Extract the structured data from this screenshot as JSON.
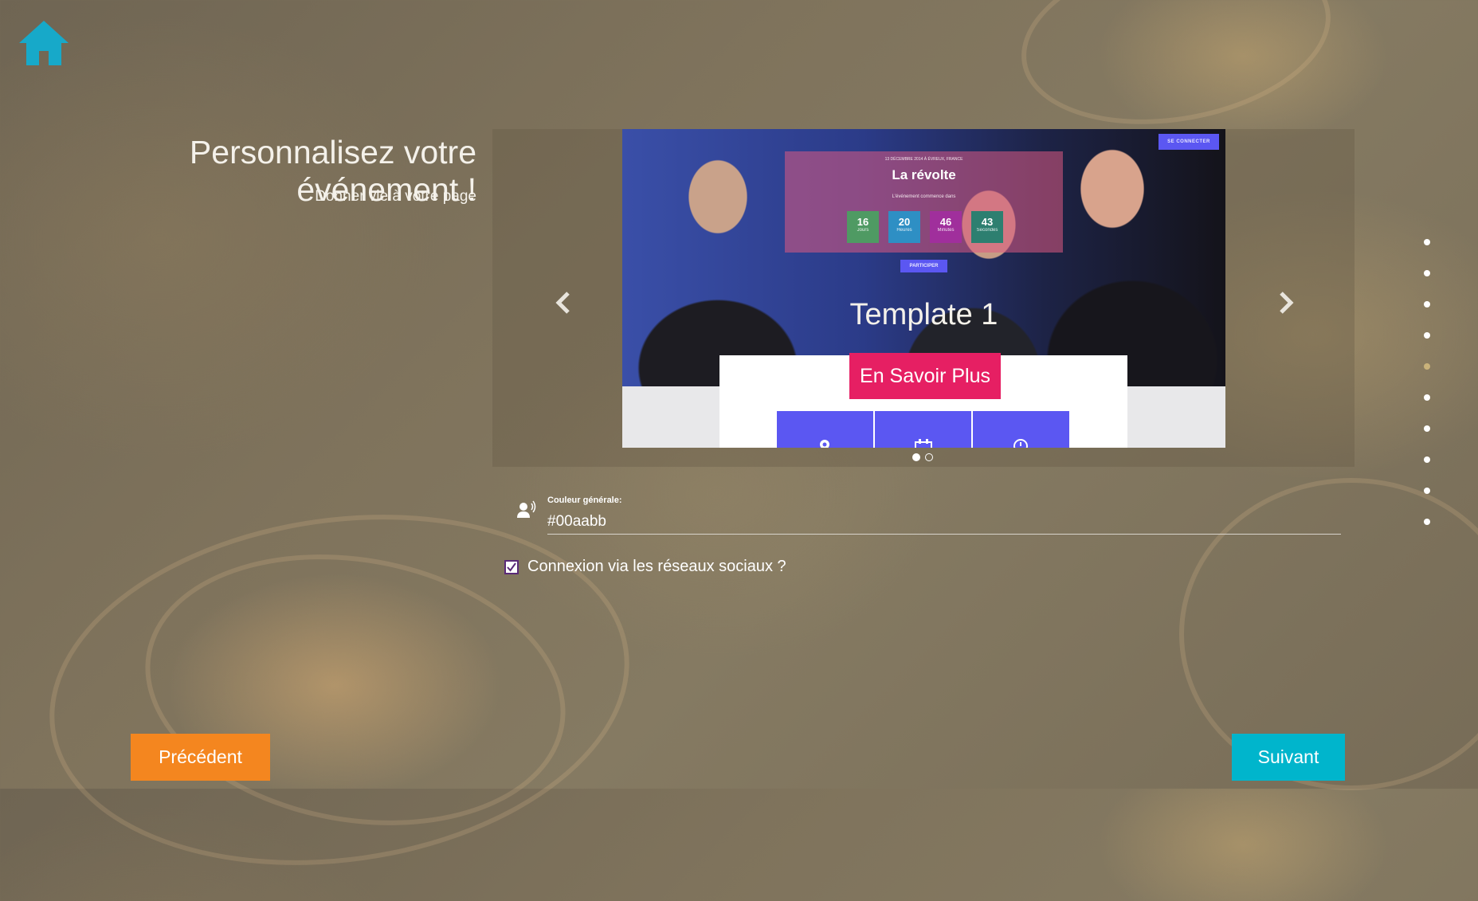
{
  "page": {
    "title": "Personnalisez votre événement !",
    "subtitle": "Donner vie à votre page"
  },
  "icons": {
    "home": "home-icon",
    "prev_arrow": "chevron-left-icon",
    "next_arrow": "chevron-right-icon",
    "field": "person-speaking-icon",
    "checkbox": "checkmark-icon"
  },
  "carousel": {
    "slide_title": "Template 1",
    "cta_label": "En Savoir Plus",
    "preview": {
      "connect_label": "SE CONNECTER",
      "date_line": "13 DÉCEMBRE 2014 À ÉVREUX, FRANCE",
      "event_title": "La révolte",
      "event_sub": "L'événement commence dans",
      "counters": [
        {
          "value": "16",
          "unit": "Jours",
          "color": "#4f9a63"
        },
        {
          "value": "20",
          "unit": "Heures",
          "color": "#2e8fc4"
        },
        {
          "value": "46",
          "unit": "Minutes",
          "color": "#a02f9c"
        },
        {
          "value": "43",
          "unit": "Secondes",
          "color": "#2d7f70"
        }
      ],
      "participate_label": "PARTICIPER"
    },
    "active_index": 0,
    "slide_count": 2
  },
  "side_nav": {
    "count": 10,
    "active_index": 4
  },
  "form": {
    "color_label": "Couleur générale:",
    "color_value": "#00aabb",
    "social_label": "Connexion via les réseaux sociaux ?",
    "social_checked": true
  },
  "nav": {
    "prev_label": "Précédent",
    "next_label": "Suivant"
  },
  "colors": {
    "accent_home": "#17a9c9",
    "prev_button": "#f4861f",
    "next_button": "#00b5cc",
    "cta": "#e61f63",
    "preview_purple": "#5b57f2"
  }
}
